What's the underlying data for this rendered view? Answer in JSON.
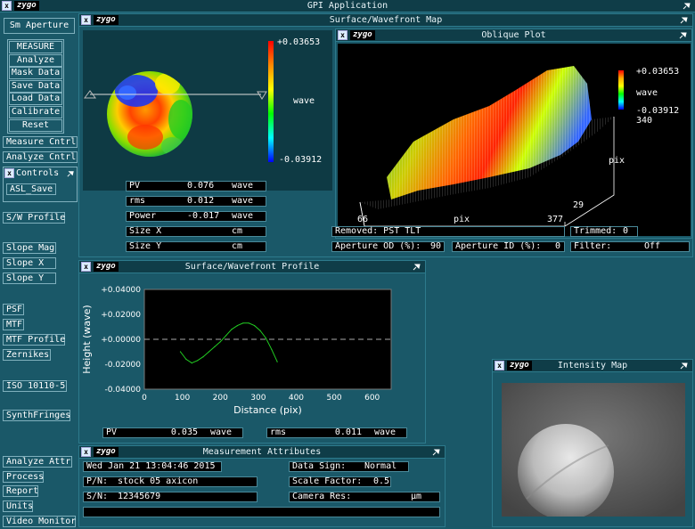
{
  "app": {
    "title": "GPI Application",
    "logo": "zygo"
  },
  "sidebar": {
    "top_label": "Sm Aperture",
    "main_buttons": [
      "MEASURE",
      "Analyze",
      "Mask Data",
      "Save Data",
      "Load Data",
      "Calibrate",
      "Reset"
    ],
    "measure_cntrl": "Measure Cntrl",
    "analyze_cntrl": "Analyze Cntrl",
    "controls_label": "Controls",
    "asl_save": "ASL_Save",
    "sw_profile": "S/W Profile",
    "slope_buttons": [
      "Slope Mag",
      "Slope X",
      "Slope Y"
    ],
    "psf_buttons": [
      "PSF",
      "MTF",
      "MTF Profile",
      "Zernikes"
    ],
    "iso": "ISO 10110-5",
    "synth": "SynthFringes",
    "bottom_buttons": [
      "Analyze Attr",
      "Process",
      "Report",
      "Units",
      "Video Monitor"
    ]
  },
  "surface_map": {
    "title": "Surface/Wavefront Map",
    "scale_max": "+0.03653",
    "scale_unit": "wave",
    "scale_min": "-0.03912",
    "stats": [
      {
        "label": "PV",
        "value": "0.076",
        "unit": "wave"
      },
      {
        "label": "rms",
        "value": "0.012",
        "unit": "wave"
      },
      {
        "label": "Power",
        "value": "-0.017",
        "unit": "wave"
      },
      {
        "label": "Size X",
        "value": "",
        "unit": "cm"
      },
      {
        "label": "Size Y",
        "value": "",
        "unit": "cm"
      }
    ]
  },
  "oblique": {
    "title": "Oblique Plot",
    "scale_max": "+0.03653",
    "scale_unit": "wave",
    "scale_min": "-0.03912",
    "y_top": "340",
    "y_label": "pix",
    "y_bottom": "29",
    "x_left": "66",
    "x_label": "pix",
    "x_right": "377"
  },
  "info_row": {
    "removed": "Removed: PST TLT",
    "trimmed_label": "Trimmed:",
    "trimmed_value": "0",
    "aperture_od_label": "Aperture OD (%):",
    "aperture_od_value": "90",
    "aperture_id_label": "Aperture ID (%):",
    "aperture_id_value": "0",
    "filter_label": "Filter:",
    "filter_value": "Off"
  },
  "profile": {
    "title": "Surface/Wavefront Profile",
    "stats": [
      {
        "label": "PV",
        "value": "0.035",
        "unit": "wave"
      },
      {
        "label": "rms",
        "value": "0.011",
        "unit": "wave"
      }
    ]
  },
  "chart_data": {
    "type": "line",
    "xlabel": "Distance (pix)",
    "ylabel": "Height (wave)",
    "xlim": [
      0,
      650
    ],
    "ylim": [
      -0.04,
      0.04
    ],
    "xticks": [
      "0",
      "100",
      "200",
      "300",
      "400",
      "500",
      "600"
    ],
    "yticks": [
      "+0.04000",
      "+0.02000",
      "+0.00000",
      "-0.02000",
      "-0.04000"
    ],
    "x": [
      95,
      110,
      125,
      140,
      155,
      170,
      185,
      200,
      215,
      230,
      245,
      260,
      275,
      290,
      305,
      320,
      335,
      350
    ],
    "values": [
      -0.01,
      -0.016,
      -0.019,
      -0.017,
      -0.014,
      -0.01,
      -0.006,
      -0.002,
      0.003,
      0.008,
      0.011,
      0.013,
      0.013,
      0.011,
      0.007,
      0.001,
      -0.008,
      -0.018
    ],
    "grid": false
  },
  "intensity": {
    "title": "Intensity Map"
  },
  "attributes": {
    "title": "Measurement Attributes",
    "date": "Wed Jan 21 13:04:46 2015",
    "pn_label": "P/N:",
    "pn_value": "stock 05 axicon",
    "sn_label": "S/N:",
    "sn_value": "12345679",
    "data_sign_label": "Data Sign:",
    "data_sign_value": "Normal",
    "scale_factor_label": "Scale Factor:",
    "scale_factor_value": "0.5",
    "camera_res_label": "Camera Res:",
    "camera_res_unit": "µm"
  },
  "colors": {
    "bg": "#1a5868",
    "title_bg": "#0f3d48",
    "profile_line": "#22cc22"
  }
}
